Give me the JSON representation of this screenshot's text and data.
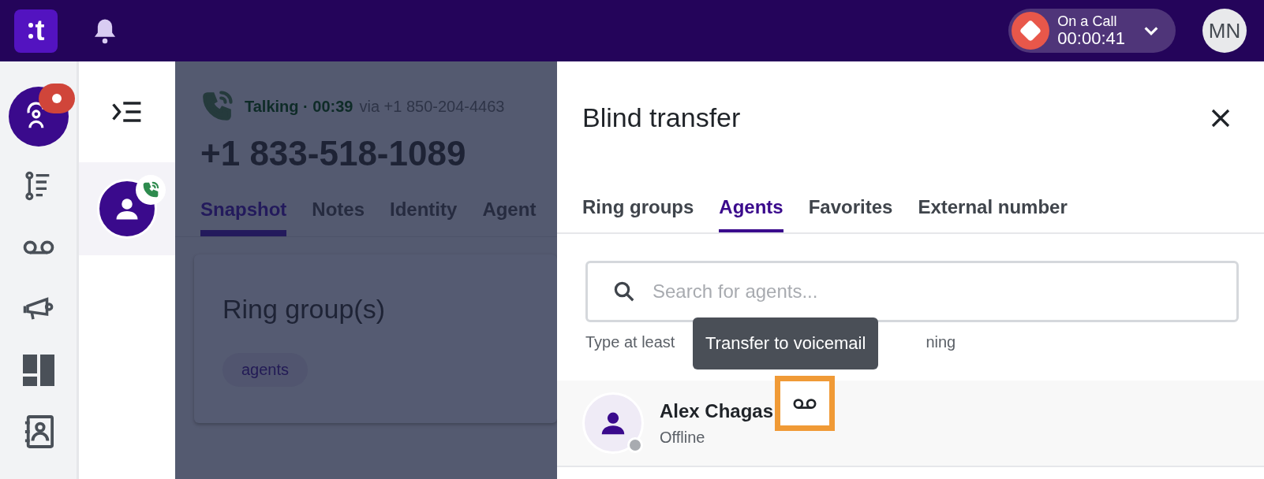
{
  "topbar": {
    "logo": "t",
    "call_status": {
      "label": "On a Call",
      "timer": "00:00:41"
    },
    "user_initials": "MN"
  },
  "rail": {
    "items": [
      {
        "kind": "agent",
        "selected": true,
        "badge": true
      },
      {
        "kind": "flow",
        "selected": false,
        "badge": false
      },
      {
        "kind": "voicemail",
        "selected": false,
        "badge": false
      },
      {
        "kind": "megaphone",
        "selected": false,
        "badge": false
      },
      {
        "kind": "dashboard",
        "selected": false,
        "badge": false
      },
      {
        "kind": "contacts",
        "selected": false,
        "badge": false
      }
    ]
  },
  "call_list": {
    "items": [
      {
        "selected": true
      }
    ]
  },
  "call": {
    "status": "Talking · 00:39",
    "via": "via +1 850-204-4463",
    "number": "+1 833-518-1089",
    "tabs": [
      {
        "label": "Snapshot",
        "selected": true
      },
      {
        "label": "Notes",
        "selected": false
      },
      {
        "label": "Identity",
        "selected": false
      },
      {
        "label": "Agent",
        "selected": false
      }
    ],
    "card": {
      "title": "Ring group(s)",
      "tags": [
        "agents"
      ]
    }
  },
  "drawer": {
    "title": "Blind transfer",
    "tabs": [
      {
        "label": "Ring groups",
        "selected": false
      },
      {
        "label": "Agents",
        "selected": true
      },
      {
        "label": "Favorites",
        "selected": false
      },
      {
        "label": "External number",
        "selected": false
      }
    ],
    "search": {
      "placeholder": "Search for agents..."
    },
    "hint_parts": [
      "Type at least",
      "ning"
    ],
    "tooltip": "Transfer to voicemail",
    "agents": [
      {
        "name": "Alex Chagas",
        "status": "Offline",
        "online": false,
        "highlighted": true
      }
    ]
  }
}
